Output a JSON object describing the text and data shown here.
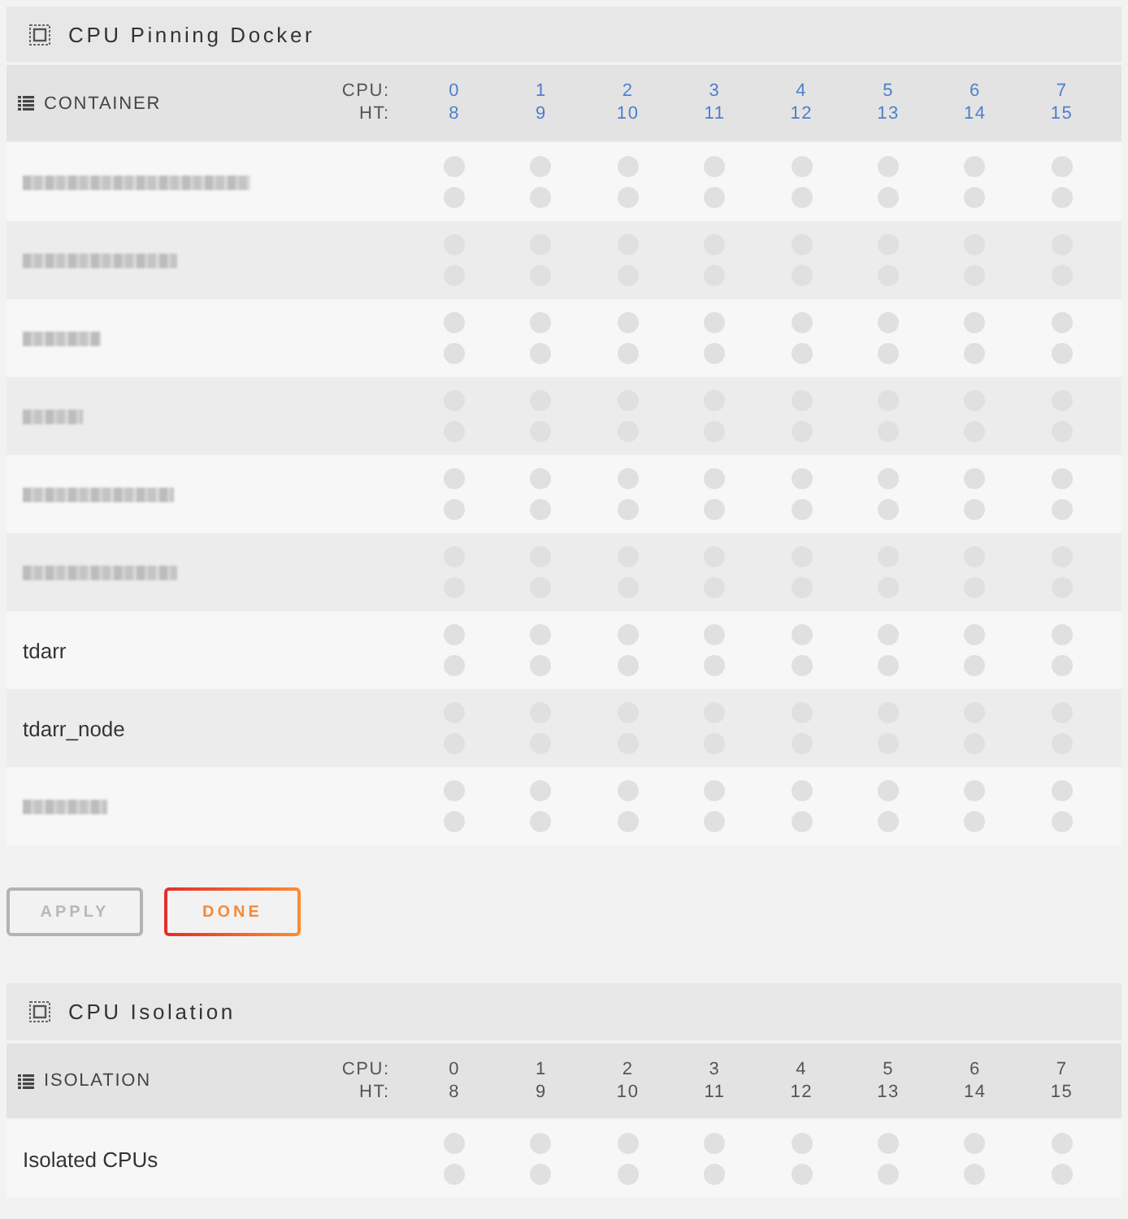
{
  "panels": [
    {
      "title": "CPU Pinning Docker",
      "header": {
        "label": "CONTAINER",
        "cpu_label": "CPU:",
        "ht_label": "HT:",
        "clickable": true,
        "cores": [
          {
            "cpu": "0",
            "ht": "8"
          },
          {
            "cpu": "1",
            "ht": "9"
          },
          {
            "cpu": "2",
            "ht": "10"
          },
          {
            "cpu": "3",
            "ht": "11"
          },
          {
            "cpu": "4",
            "ht": "12"
          },
          {
            "cpu": "5",
            "ht": "13"
          },
          {
            "cpu": "6",
            "ht": "14"
          },
          {
            "cpu": "7",
            "ht": "15"
          }
        ]
      },
      "rows": [
        {
          "kind": "redacted",
          "cores": [
            {
              "cpu_checked": false,
              "ht_checked": false
            },
            {
              "cpu_checked": false,
              "ht_checked": false
            },
            {
              "cpu_checked": false,
              "ht_checked": false
            },
            {
              "cpu_checked": false,
              "ht_checked": false
            },
            {
              "cpu_checked": false,
              "ht_checked": false
            },
            {
              "cpu_checked": false,
              "ht_checked": false
            },
            {
              "cpu_checked": false,
              "ht_checked": false
            },
            {
              "cpu_checked": false,
              "ht_checked": false
            }
          ]
        },
        {
          "kind": "redacted",
          "cores": [
            {
              "cpu_checked": false,
              "ht_checked": false
            },
            {
              "cpu_checked": false,
              "ht_checked": false
            },
            {
              "cpu_checked": false,
              "ht_checked": false
            },
            {
              "cpu_checked": false,
              "ht_checked": false
            },
            {
              "cpu_checked": false,
              "ht_checked": false
            },
            {
              "cpu_checked": false,
              "ht_checked": false
            },
            {
              "cpu_checked": false,
              "ht_checked": false
            },
            {
              "cpu_checked": false,
              "ht_checked": false
            }
          ]
        },
        {
          "kind": "redacted",
          "cores": [
            {
              "cpu_checked": false,
              "ht_checked": false
            },
            {
              "cpu_checked": false,
              "ht_checked": false
            },
            {
              "cpu_checked": false,
              "ht_checked": false
            },
            {
              "cpu_checked": false,
              "ht_checked": false
            },
            {
              "cpu_checked": false,
              "ht_checked": false
            },
            {
              "cpu_checked": false,
              "ht_checked": false
            },
            {
              "cpu_checked": false,
              "ht_checked": false
            },
            {
              "cpu_checked": false,
              "ht_checked": false
            }
          ]
        },
        {
          "kind": "redacted",
          "cores": [
            {
              "cpu_checked": false,
              "ht_checked": false
            },
            {
              "cpu_checked": false,
              "ht_checked": false
            },
            {
              "cpu_checked": false,
              "ht_checked": false
            },
            {
              "cpu_checked": false,
              "ht_checked": false
            },
            {
              "cpu_checked": false,
              "ht_checked": false
            },
            {
              "cpu_checked": false,
              "ht_checked": false
            },
            {
              "cpu_checked": false,
              "ht_checked": false
            },
            {
              "cpu_checked": false,
              "ht_checked": false
            }
          ]
        },
        {
          "kind": "redacted",
          "cores": [
            {
              "cpu_checked": false,
              "ht_checked": false
            },
            {
              "cpu_checked": false,
              "ht_checked": false
            },
            {
              "cpu_checked": false,
              "ht_checked": false
            },
            {
              "cpu_checked": false,
              "ht_checked": false
            },
            {
              "cpu_checked": false,
              "ht_checked": false
            },
            {
              "cpu_checked": false,
              "ht_checked": false
            },
            {
              "cpu_checked": false,
              "ht_checked": false
            },
            {
              "cpu_checked": false,
              "ht_checked": false
            }
          ]
        },
        {
          "kind": "redacted",
          "cores": [
            {
              "cpu_checked": false,
              "ht_checked": false
            },
            {
              "cpu_checked": false,
              "ht_checked": false
            },
            {
              "cpu_checked": false,
              "ht_checked": false
            },
            {
              "cpu_checked": false,
              "ht_checked": false
            },
            {
              "cpu_checked": false,
              "ht_checked": false
            },
            {
              "cpu_checked": false,
              "ht_checked": false
            },
            {
              "cpu_checked": false,
              "ht_checked": false
            },
            {
              "cpu_checked": false,
              "ht_checked": false
            }
          ]
        },
        {
          "kind": "named",
          "name": "tdarr",
          "cores": [
            {
              "cpu_checked": false,
              "ht_checked": false
            },
            {
              "cpu_checked": false,
              "ht_checked": false
            },
            {
              "cpu_checked": false,
              "ht_checked": false
            },
            {
              "cpu_checked": false,
              "ht_checked": false
            },
            {
              "cpu_checked": false,
              "ht_checked": false
            },
            {
              "cpu_checked": false,
              "ht_checked": false
            },
            {
              "cpu_checked": false,
              "ht_checked": false
            },
            {
              "cpu_checked": false,
              "ht_checked": false
            }
          ]
        },
        {
          "kind": "named",
          "name": "tdarr_node",
          "cores": [
            {
              "cpu_checked": false,
              "ht_checked": false
            },
            {
              "cpu_checked": false,
              "ht_checked": false
            },
            {
              "cpu_checked": false,
              "ht_checked": false
            },
            {
              "cpu_checked": false,
              "ht_checked": false
            },
            {
              "cpu_checked": false,
              "ht_checked": false
            },
            {
              "cpu_checked": false,
              "ht_checked": false
            },
            {
              "cpu_checked": false,
              "ht_checked": false
            },
            {
              "cpu_checked": false,
              "ht_checked": false
            }
          ]
        },
        {
          "kind": "redacted",
          "cores": [
            {
              "cpu_checked": false,
              "ht_checked": false
            },
            {
              "cpu_checked": false,
              "ht_checked": false
            },
            {
              "cpu_checked": false,
              "ht_checked": false
            },
            {
              "cpu_checked": false,
              "ht_checked": false
            },
            {
              "cpu_checked": false,
              "ht_checked": false
            },
            {
              "cpu_checked": false,
              "ht_checked": false
            },
            {
              "cpu_checked": false,
              "ht_checked": false
            },
            {
              "cpu_checked": false,
              "ht_checked": false
            }
          ]
        }
      ],
      "actions": [
        {
          "label": "APPLY",
          "disabled": true
        },
        {
          "label": "DONE",
          "disabled": false
        }
      ]
    },
    {
      "title": "CPU Isolation",
      "header": {
        "label": "ISOLATION",
        "cpu_label": "CPU:",
        "ht_label": "HT:",
        "clickable": false,
        "cores": [
          {
            "cpu": "0",
            "ht": "8"
          },
          {
            "cpu": "1",
            "ht": "9"
          },
          {
            "cpu": "2",
            "ht": "10"
          },
          {
            "cpu": "3",
            "ht": "11"
          },
          {
            "cpu": "4",
            "ht": "12"
          },
          {
            "cpu": "5",
            "ht": "13"
          },
          {
            "cpu": "6",
            "ht": "14"
          },
          {
            "cpu": "7",
            "ht": "15"
          }
        ]
      },
      "rows": [
        {
          "kind": "named",
          "name": "Isolated CPUs",
          "cores": [
            {
              "cpu_checked": false,
              "ht_checked": false
            },
            {
              "cpu_checked": false,
              "ht_checked": false
            },
            {
              "cpu_checked": false,
              "ht_checked": false
            },
            {
              "cpu_checked": false,
              "ht_checked": false
            },
            {
              "cpu_checked": false,
              "ht_checked": false
            },
            {
              "cpu_checked": false,
              "ht_checked": false
            },
            {
              "cpu_checked": false,
              "ht_checked": false
            },
            {
              "cpu_checked": false,
              "ht_checked": false
            }
          ]
        }
      ]
    }
  ]
}
